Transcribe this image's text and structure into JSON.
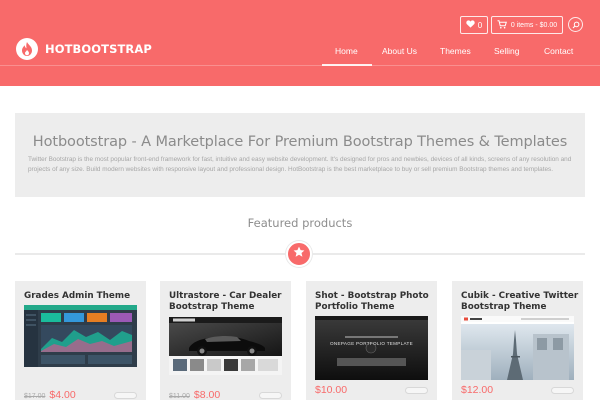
{
  "brand": {
    "name": "HOTBOOTSTRAP",
    "accent": "#f86a6a",
    "logo_icon": "flame-icon"
  },
  "header": {
    "wishlist": {
      "icon": "heart-icon",
      "count": "0"
    },
    "cart": {
      "icon": "cart-icon",
      "label": "0 items - $0.00"
    },
    "search_icon": "search-icon"
  },
  "nav": {
    "items": [
      {
        "label": "Home",
        "active": true
      },
      {
        "label": "About Us",
        "active": false
      },
      {
        "label": "Themes",
        "active": false
      },
      {
        "label": "Selling",
        "active": false
      },
      {
        "label": "Contact",
        "active": false
      }
    ]
  },
  "hero": {
    "title": "Hotbootstrap - A Marketplace For Premium Bootstrap Themes & Templates",
    "description": "Twitter Bootstrap is the most popular front-end framework for fast, intuitive and easy website development. It's designed for pros and newbies, devices of all kinds, screens of any resolution and projects of any size. Build modern websites with responsive layout and professional design. HotBootstrap is the best marketplace to buy or sell premium Bootstrap themes and templates."
  },
  "featured": {
    "title": "Featured products",
    "badge_icon": "star-icon"
  },
  "products": [
    {
      "title": "Grades Admin Theme",
      "old_price": "$17.00",
      "price": "$4.00"
    },
    {
      "title": "Ultrastore - Car Dealer Bootstrap Theme",
      "old_price": "$11.00",
      "price": "$8.00"
    },
    {
      "title": "Shot - Bootstrap Photo Portfolio Theme",
      "old_price": "",
      "price": "$10.00",
      "thumb_caption": "ONEPAGE PORTFOLIO TEMPLATE"
    },
    {
      "title": "Cubik - Creative Twitter Bootstrap Theme",
      "old_price": "",
      "price": "$12.00"
    }
  ]
}
